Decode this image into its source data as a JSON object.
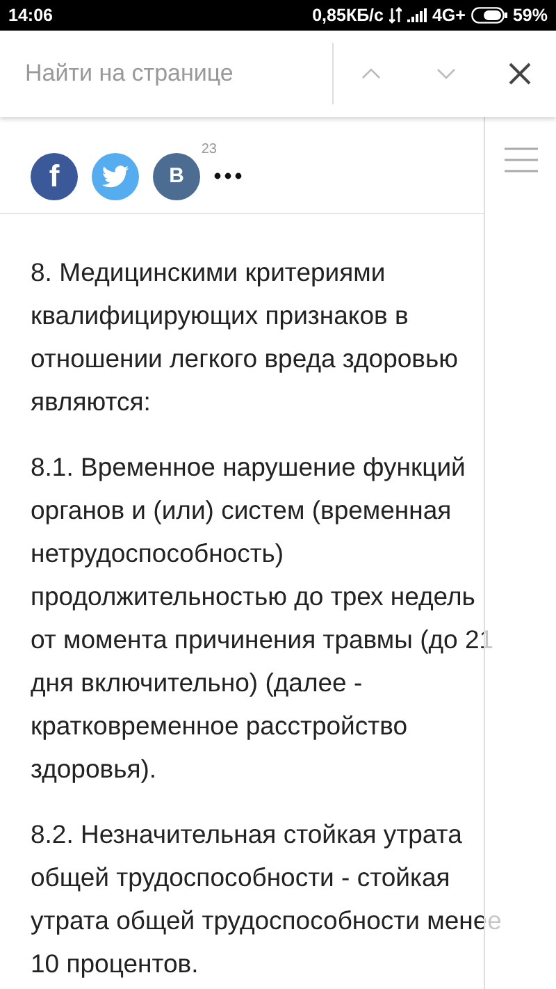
{
  "status_bar": {
    "time": "14:06",
    "speed": "0,85КБ/с",
    "network": "4G+",
    "battery": "59%"
  },
  "find_bar": {
    "placeholder": "Найти на странице"
  },
  "share": {
    "buttons": [
      {
        "kind": "facebook",
        "label": "f"
      },
      {
        "kind": "twitter"
      },
      {
        "kind": "vk",
        "label": "B",
        "count": "23"
      }
    ]
  },
  "article": {
    "paragraphs": [
      {
        "lines": [
          "8. Медицинскими критериями",
          "квалифицирующих признаков в",
          "отношении легкого вреда здоровью",
          "являются:"
        ]
      },
      {
        "lines": [
          "8.1. Временное нарушение функций",
          "органов и (или) систем (временная",
          "нетрудоспособность)",
          "продолжительностью до трех недель",
          "от момента причинения травмы (до 21",
          "дня включительно) (далее -",
          "кратковременное расстройство",
          "здоровья)."
        ]
      },
      {
        "lines": [
          "8.2. Незначительная стойкая утрата",
          "общей трудоспособности - стойкая",
          "утрата общей трудоспособности менее",
          "10 процентов."
        ]
      }
    ]
  }
}
